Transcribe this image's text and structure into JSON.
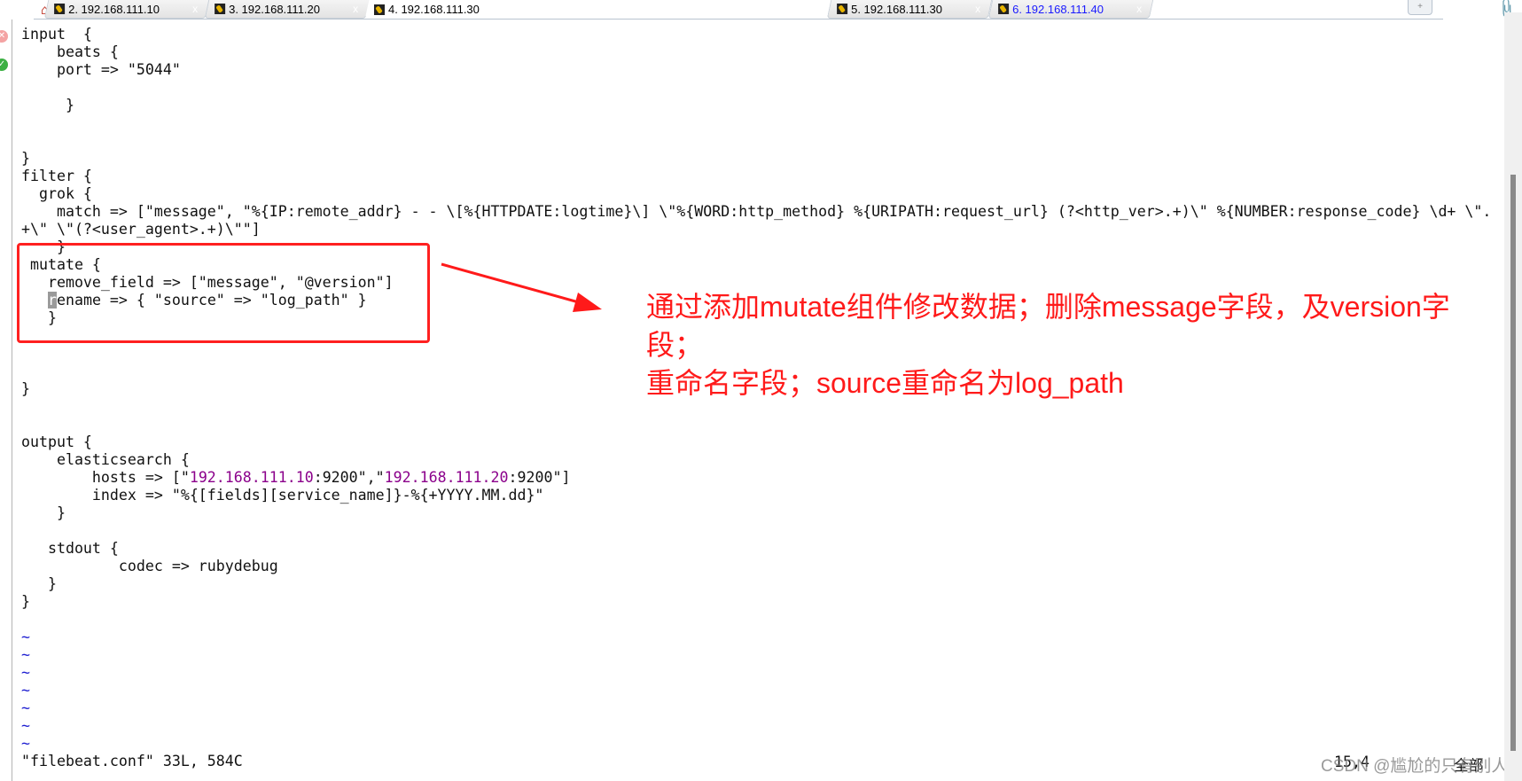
{
  "tabs": {
    "home_icon": "home-icon",
    "items": [
      {
        "label": "2. 192.168.111.10",
        "active": false,
        "color": "#000000"
      },
      {
        "label": "3. 192.168.111.20",
        "active": false,
        "color": "#000000"
      },
      {
        "label": "4. 192.168.111.30",
        "active": true,
        "color": "#000000"
      },
      {
        "label": "5. 192.168.111.30",
        "active": false,
        "color": "#000000"
      },
      {
        "label": "6. 192.168.111.40",
        "active": false,
        "color": "#1a1aff"
      }
    ],
    "close_glyph": "x",
    "new_tab_glyph": "+"
  },
  "editor": {
    "string_color": "#8b008b",
    "lines": [
      [
        {
          "t": "input  {"
        }
      ],
      [
        {
          "t": "    beats {"
        }
      ],
      [
        {
          "t": "    port => \"5044\""
        }
      ],
      [
        {
          "t": ""
        }
      ],
      [
        {
          "t": "     }"
        }
      ],
      [
        {
          "t": ""
        }
      ],
      [
        {
          "t": ""
        }
      ],
      [
        {
          "t": "}"
        }
      ],
      [
        {
          "t": "filter {"
        }
      ],
      [
        {
          "t": "  grok {"
        }
      ],
      [
        {
          "t": "    match => [\"message\", \"%{IP:remote_addr} - - \\[%{HTTPDATE:logtime}\\] \\\"%{WORD:http_method} %{URIPATH:request_url} (?<http_ver>.+)\\\" %{NUMBER:response_code} \\d+ \\\"."
        }
      ],
      [
        {
          "t": "+\\\" \\\"(?<user_agent>.+)\\\"\"]"
        }
      ],
      [
        {
          "t": "    }"
        }
      ],
      [
        {
          "t": " mutate {"
        }
      ],
      [
        {
          "t": "   remove_field => [\"message\", \"@version\"]"
        }
      ],
      [
        {
          "t": "   "
        },
        {
          "t": "r",
          "cursor": true
        },
        {
          "t": "ename => { \"source\" => \"log_path\" }"
        }
      ],
      [
        {
          "t": "   }"
        }
      ],
      [
        {
          "t": ""
        }
      ],
      [
        {
          "t": ""
        }
      ],
      [
        {
          "t": ""
        }
      ],
      [
        {
          "t": "}"
        }
      ],
      [
        {
          "t": ""
        }
      ],
      [
        {
          "t": ""
        }
      ],
      [
        {
          "t": "output {"
        }
      ],
      [
        {
          "t": "    elasticsearch {"
        }
      ],
      [
        {
          "t": "        hosts => [\""
        },
        {
          "t": "192.168.111.10",
          "str": true
        },
        {
          "t": ":9200\",\""
        },
        {
          "t": "192.168.111.20",
          "str": true
        },
        {
          "t": ":9200\"]"
        }
      ],
      [
        {
          "t": "        index => \"%{[fields][service_name]}-%{+YYYY.MM.dd}\""
        }
      ],
      [
        {
          "t": "    }"
        }
      ],
      [
        {
          "t": ""
        }
      ],
      [
        {
          "t": "   stdout {"
        }
      ],
      [
        {
          "t": "           codec => rubydebug"
        }
      ],
      [
        {
          "t": "   }"
        }
      ],
      [
        {
          "t": "}"
        }
      ],
      [
        {
          "t": ""
        }
      ],
      [
        {
          "t": "~",
          "tilde": true
        }
      ],
      [
        {
          "t": "~",
          "tilde": true
        }
      ],
      [
        {
          "t": "~",
          "tilde": true
        }
      ],
      [
        {
          "t": "~",
          "tilde": true
        }
      ],
      [
        {
          "t": "~",
          "tilde": true
        }
      ],
      [
        {
          "t": "~",
          "tilde": true
        }
      ],
      [
        {
          "t": "~",
          "tilde": true
        }
      ],
      [
        {
          "t": "\"filebeat.conf\" 33L, 584C"
        }
      ]
    ]
  },
  "status": {
    "position": "15,4",
    "scroll": "全部"
  },
  "annotation": {
    "text_lines": [
      "通过添加mutate组件修改数据；删除message字段，及version字段；",
      "重命名字段；source重命名为log_path"
    ],
    "color": "#ff1a1a"
  },
  "watermark": "CSDN @尴尬的只有别人"
}
